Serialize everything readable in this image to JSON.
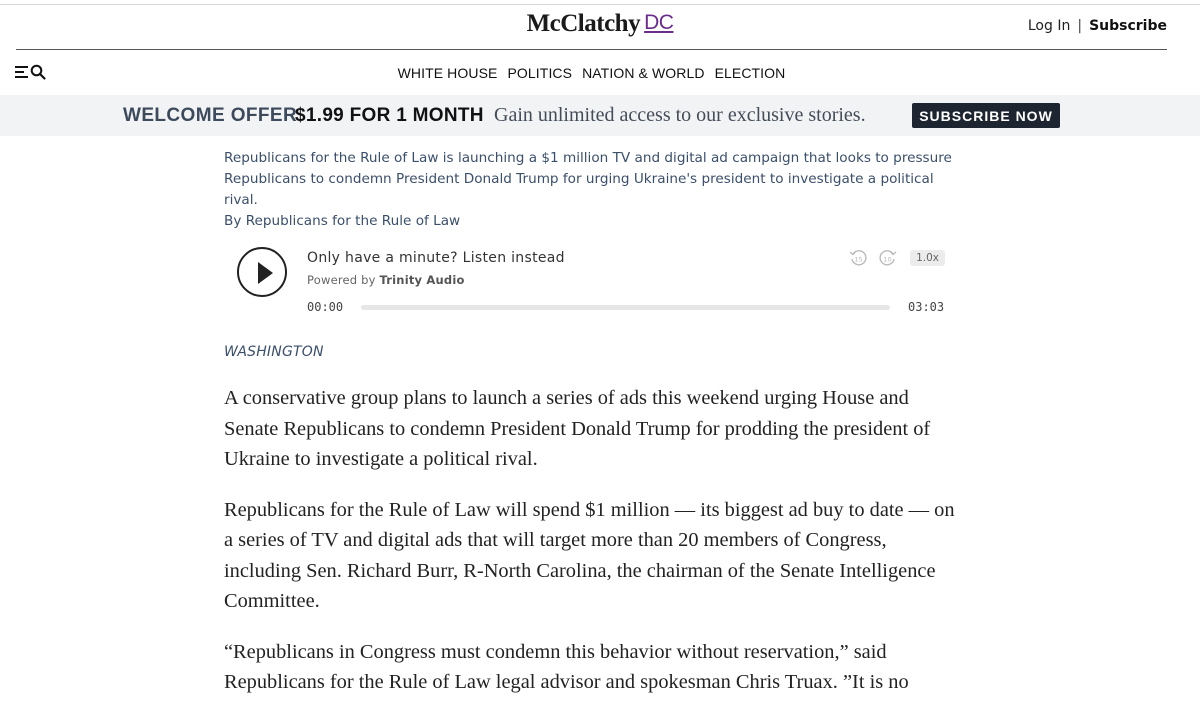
{
  "header": {
    "logo_text": "McClatchy",
    "logo_suffix": "DC",
    "login": "Log In",
    "separator": "|",
    "subscribe": "Subscribe"
  },
  "nav": {
    "items": [
      "WHITE HOUSE",
      "POLITICS",
      "NATION & WORLD",
      "ELECTION"
    ]
  },
  "welcome_bar": {
    "label": "WELCOME OFFER",
    "price": "$1.99 FOR 1 MONTH",
    "message": "Gain unlimited access to our exclusive stories.",
    "cta": "SUBSCRIBE NOW"
  },
  "caption": {
    "line1": "Republicans for the Rule of Law is launching a $1 million TV and digital ad campaign that looks to pressure",
    "line2": "Republicans to condemn President Donald Trump for urging Ukraine's president to investigate a political rival.",
    "credit": "By Republicans for the Rule of Law"
  },
  "audio_player": {
    "title": "Only have a minute? Listen instead",
    "powered_by": "Powered by",
    "provider": "Trinity Audio",
    "rewind_label": "15",
    "forward_label": "10",
    "speed": "1.0x",
    "current_time": "00:00",
    "duration": "03:03",
    "progress": 0
  },
  "article": {
    "dateline": "WASHINGTON",
    "paragraphs": [
      "A conservative group plans to launch a series of ads this weekend urging House and Senate Republicans to condemn President Donald Trump for prodding the president of Ukraine to investigate a political rival.",
      "Republicans for the Rule of Law will spend $1 million — its biggest ad buy to date — on a series of TV and digital ads that will target more than 20 members of Congress, including Sen. Richard Burr, R-North Carolina, the chairman of the Senate Intelligence Committee.",
      "“Republicans in Congress must condemn this behavior without reservation,” said Republicans for the Rule of Law legal advisor and spokesman Chris Truax. ”It is no"
    ]
  },
  "colors": {
    "brand_purple": "#6b2d8a",
    "welcome_bg": "#f2f3f5",
    "cta_bg": "#1d2530",
    "caption_blue": "#3b4f6b"
  }
}
